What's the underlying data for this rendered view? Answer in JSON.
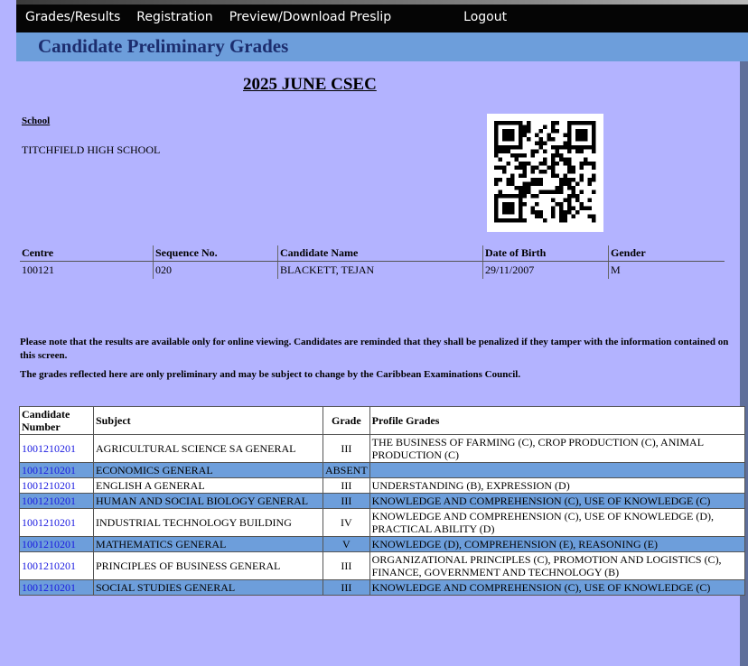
{
  "nav": {
    "items": [
      "Grades/Results",
      "Registration",
      "Preview/Download Preslip"
    ],
    "logout": "Logout"
  },
  "page_title": "Candidate Preliminary Grades",
  "exam_title": "2025 JUNE CSEC",
  "school": {
    "label": "School",
    "name": "TITCHFIELD HIGH SCHOOL"
  },
  "candidate": {
    "headers": [
      "Centre",
      "Sequence No.",
      "Candidate Name",
      "Date of Birth",
      "Gender"
    ],
    "values": [
      "100121",
      "020",
      "BLACKETT, TEJAN",
      "29/11/2007",
      "M"
    ]
  },
  "notice": [
    "Please note that the results are available only for online viewing. Candidates are reminded that they shall be penalized if they tamper with the information contained on this screen.",
    "The grades reflected here are only preliminary and may be subject to change by the Caribbean Examinations Council."
  ],
  "grades": {
    "headers": [
      "Candidate Number",
      "Subject",
      "Grade",
      "Profile Grades"
    ],
    "rows": [
      [
        "1001210201",
        "AGRICULTURAL SCIENCE SA GENERAL",
        "III",
        "THE BUSINESS OF FARMING (C), CROP PRODUCTION (C), ANIMAL PRODUCTION (C)"
      ],
      [
        "1001210201",
        "ECONOMICS GENERAL",
        "ABSENT",
        ""
      ],
      [
        "1001210201",
        "ENGLISH A GENERAL",
        "III",
        "UNDERSTANDING (B), EXPRESSION (D)"
      ],
      [
        "1001210201",
        "HUMAN AND SOCIAL BIOLOGY GENERAL",
        "III",
        "KNOWLEDGE AND COMPREHENSION (C), USE OF KNOWLEDGE (C)"
      ],
      [
        "1001210201",
        "INDUSTRIAL TECHNOLOGY BUILDING",
        "IV",
        "KNOWLEDGE AND COMPREHENSION (C), USE OF KNOWLEDGE (D), PRACTICAL ABILITY (D)"
      ],
      [
        "1001210201",
        "MATHEMATICS GENERAL",
        "V",
        "KNOWLEDGE (D), COMPREHENSION (E), REASONING (E)"
      ],
      [
        "1001210201",
        "PRINCIPLES OF BUSINESS GENERAL",
        "III",
        "ORGANIZATIONAL PRINCIPLES (C), PROMOTION AND LOGISTICS (C), FINANCE, GOVERNMENT AND TECHNOLOGY (B)"
      ],
      [
        "1001210201",
        "SOCIAL STUDIES GENERAL",
        "III",
        "KNOWLEDGE AND COMPREHENSION (C), USE OF KNOWLEDGE (C)"
      ]
    ]
  }
}
